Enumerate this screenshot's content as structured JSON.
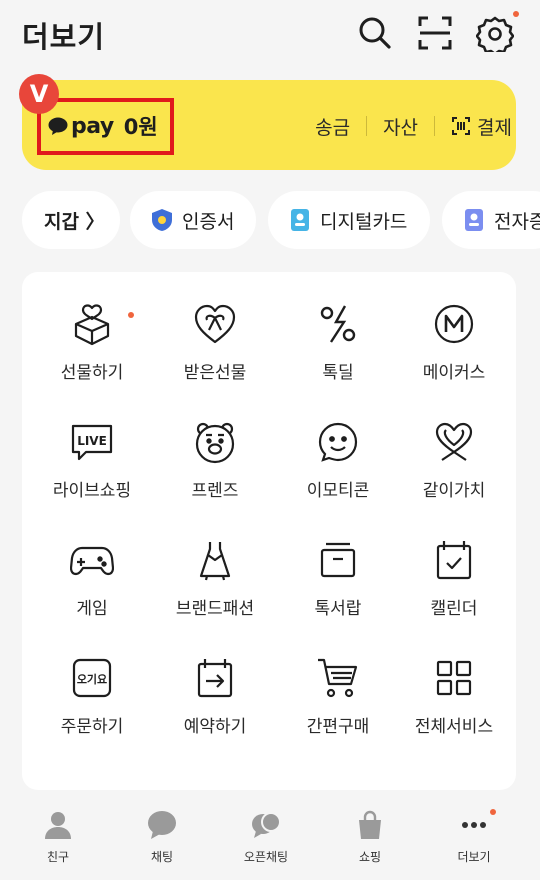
{
  "header": {
    "title": "더보기",
    "icons": [
      "search-icon",
      "scan-icon",
      "settings-icon"
    ],
    "settings_has_badge": true
  },
  "pay": {
    "badge": "V",
    "brand": "pay",
    "balance": "0원",
    "actions": [
      {
        "label": "송금"
      },
      {
        "label": "자산"
      },
      {
        "label": "결제",
        "icon": "scan-pay-icon"
      }
    ],
    "bg_color": "#fae54d",
    "highlight_color": "#e0191c"
  },
  "chips": [
    {
      "label": "지갑 〉",
      "icon": ""
    },
    {
      "label": "인증서",
      "icon": "shield-icon"
    },
    {
      "label": "디지털카드",
      "icon": "id-card-icon"
    },
    {
      "label": "전자증",
      "icon": "doc-icon"
    }
  ],
  "services": [
    {
      "label": "선물하기",
      "icon": "gift-box-icon",
      "badge": true
    },
    {
      "label": "받은선물",
      "icon": "received-gift-icon",
      "badge": false
    },
    {
      "label": "톡딜",
      "icon": "percent-icon",
      "badge": false
    },
    {
      "label": "메이커스",
      "icon": "makers-icon",
      "badge": false
    },
    {
      "label": "라이브쇼핑",
      "icon": "live-icon",
      "badge": false
    },
    {
      "label": "프렌즈",
      "icon": "bear-icon",
      "badge": false
    },
    {
      "label": "이모티콘",
      "icon": "emoticon-icon",
      "badge": false
    },
    {
      "label": "같이가치",
      "icon": "heart-ribbon-icon",
      "badge": false
    },
    {
      "label": "게임",
      "icon": "gamepad-icon",
      "badge": false
    },
    {
      "label": "브랜드패션",
      "icon": "dress-icon",
      "badge": false
    },
    {
      "label": "톡서랍",
      "icon": "drawer-icon",
      "badge": false
    },
    {
      "label": "캘린더",
      "icon": "calendar-icon",
      "badge": false
    },
    {
      "label": "주문하기",
      "icon": "order-icon",
      "icon_text": "오기요",
      "badge": false
    },
    {
      "label": "예약하기",
      "icon": "reserve-icon",
      "badge": false
    },
    {
      "label": "간편구매",
      "icon": "cart-icon",
      "badge": false
    },
    {
      "label": "전체서비스",
      "icon": "grid-icon",
      "badge": false
    }
  ],
  "tabs": [
    {
      "label": "친구",
      "icon": "person-icon"
    },
    {
      "label": "채팅",
      "icon": "chat-icon"
    },
    {
      "label": "오픈채팅",
      "icon": "open-chat-icon"
    },
    {
      "label": "쇼핑",
      "icon": "shopping-bag-icon"
    },
    {
      "label": "더보기",
      "icon": "more-icon",
      "active": true,
      "badge": true
    }
  ]
}
